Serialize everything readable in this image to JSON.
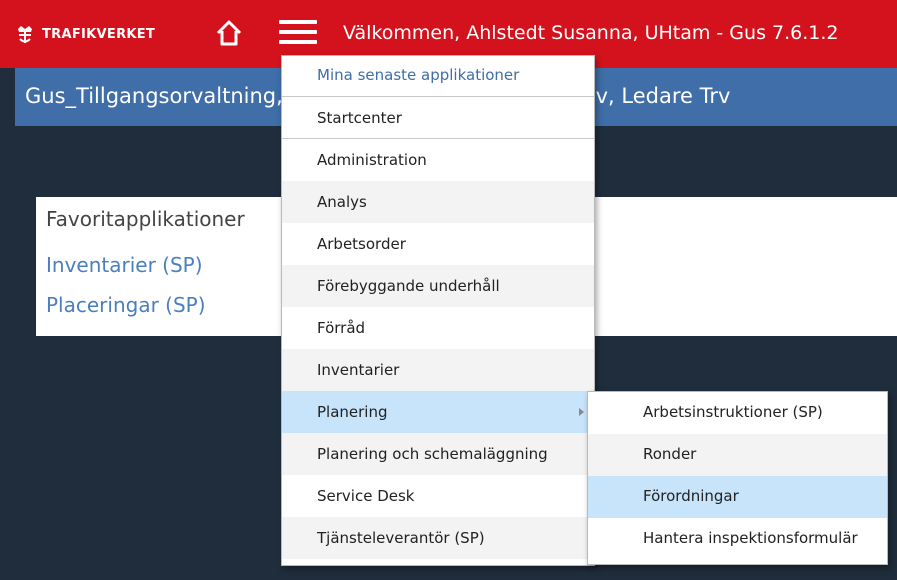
{
  "topbar": {
    "logo_text": "TRAFIKVERKET",
    "welcome": "Välkommen, Ahlstedt Susanna, UHtam - Gus 7.6.1.2"
  },
  "titlebar": {
    "title": "Gus_Tillgangsorvaltning, Startcenter för Leverantör Lev, Ledare Trv"
  },
  "favorites": {
    "heading": "Favoritapplikationer",
    "links": [
      "Inventarier (SP)",
      "Placeringar (SP)"
    ]
  },
  "menu": {
    "header": "Mina senaste applikationer",
    "items": [
      {
        "label": "Startcenter"
      },
      {
        "label": "Administration"
      },
      {
        "label": "Analys"
      },
      {
        "label": "Arbetsorder"
      },
      {
        "label": "Förebyggande underhåll"
      },
      {
        "label": "Förråd"
      },
      {
        "label": "Inventarier"
      },
      {
        "label": "Planering"
      },
      {
        "label": "Planering och schemaläggning"
      },
      {
        "label": "Service Desk"
      },
      {
        "label": "Tjänsteleverantör (SP)"
      }
    ]
  },
  "submenu": {
    "items": [
      {
        "label": "Arbetsinstruktioner (SP)"
      },
      {
        "label": "Ronder"
      },
      {
        "label": "Förordningar"
      },
      {
        "label": "Hantera inspektionsformulär"
      }
    ]
  },
  "colors": {
    "topbar": "#d3121d",
    "titlebar": "#3f6ea8",
    "background": "#1f2d3c",
    "highlight": "#c7e4fb",
    "link": "#4a7fc0"
  },
  "icons": {
    "logo": "trafikverket-crown-icon",
    "home": "home-icon",
    "menu": "hamburger-menu-icon",
    "submenu_arrow": "chevron-right-icon"
  }
}
